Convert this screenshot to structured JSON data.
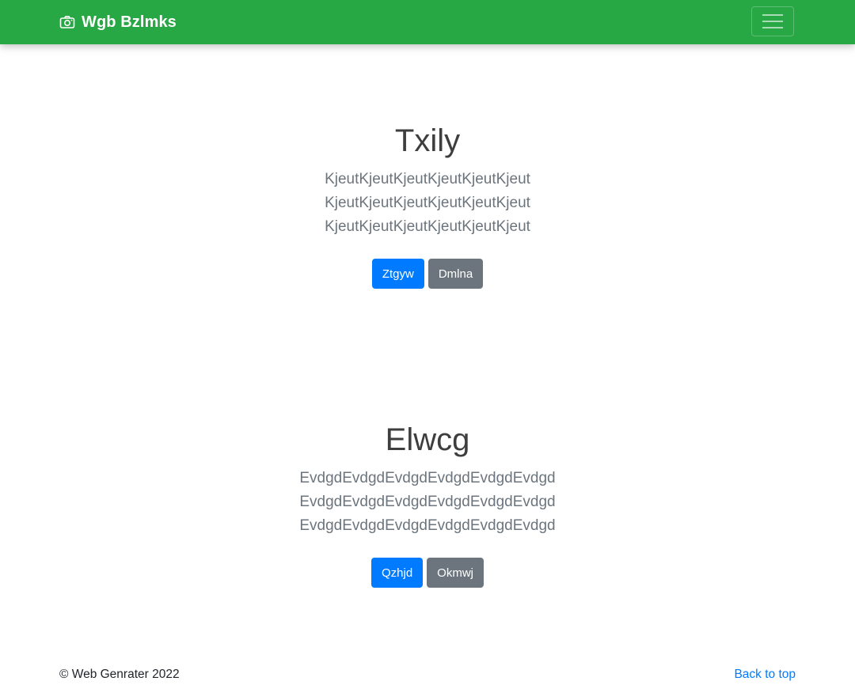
{
  "navbar": {
    "brand": "Wgb Bzlmks",
    "brand_icon": "camera-icon",
    "toggler_icon": "hamburger-menu-icon",
    "background_color": "#28a745"
  },
  "sections": [
    {
      "heading": "Txily",
      "lead": "KjeutKjeutKjeutKjeutKjeutKjeut KjeutKjeutKjeutKjeutKjeutKjeut KjeutKjeutKjeutKjeutKjeutKjeut",
      "primary_button": "Ztgyw",
      "secondary_button": "Dmlna"
    },
    {
      "heading": "Elwcg",
      "lead": "EvdgdEvdgdEvdgdEvdgdEvdgdEvdgd EvdgdEvdgdEvdgdEvdgdEvdgdEvdgd EvdgdEvdgdEvdgdEvdgdEvdgdEvdgd",
      "primary_button": "Qzhjd",
      "secondary_button": "Okmwj"
    }
  ],
  "footer": {
    "copyright": "© Web Genrater 2022",
    "back_to_top": "Back to top"
  },
  "colors": {
    "primary": "#007bff",
    "secondary": "#6c757d"
  }
}
